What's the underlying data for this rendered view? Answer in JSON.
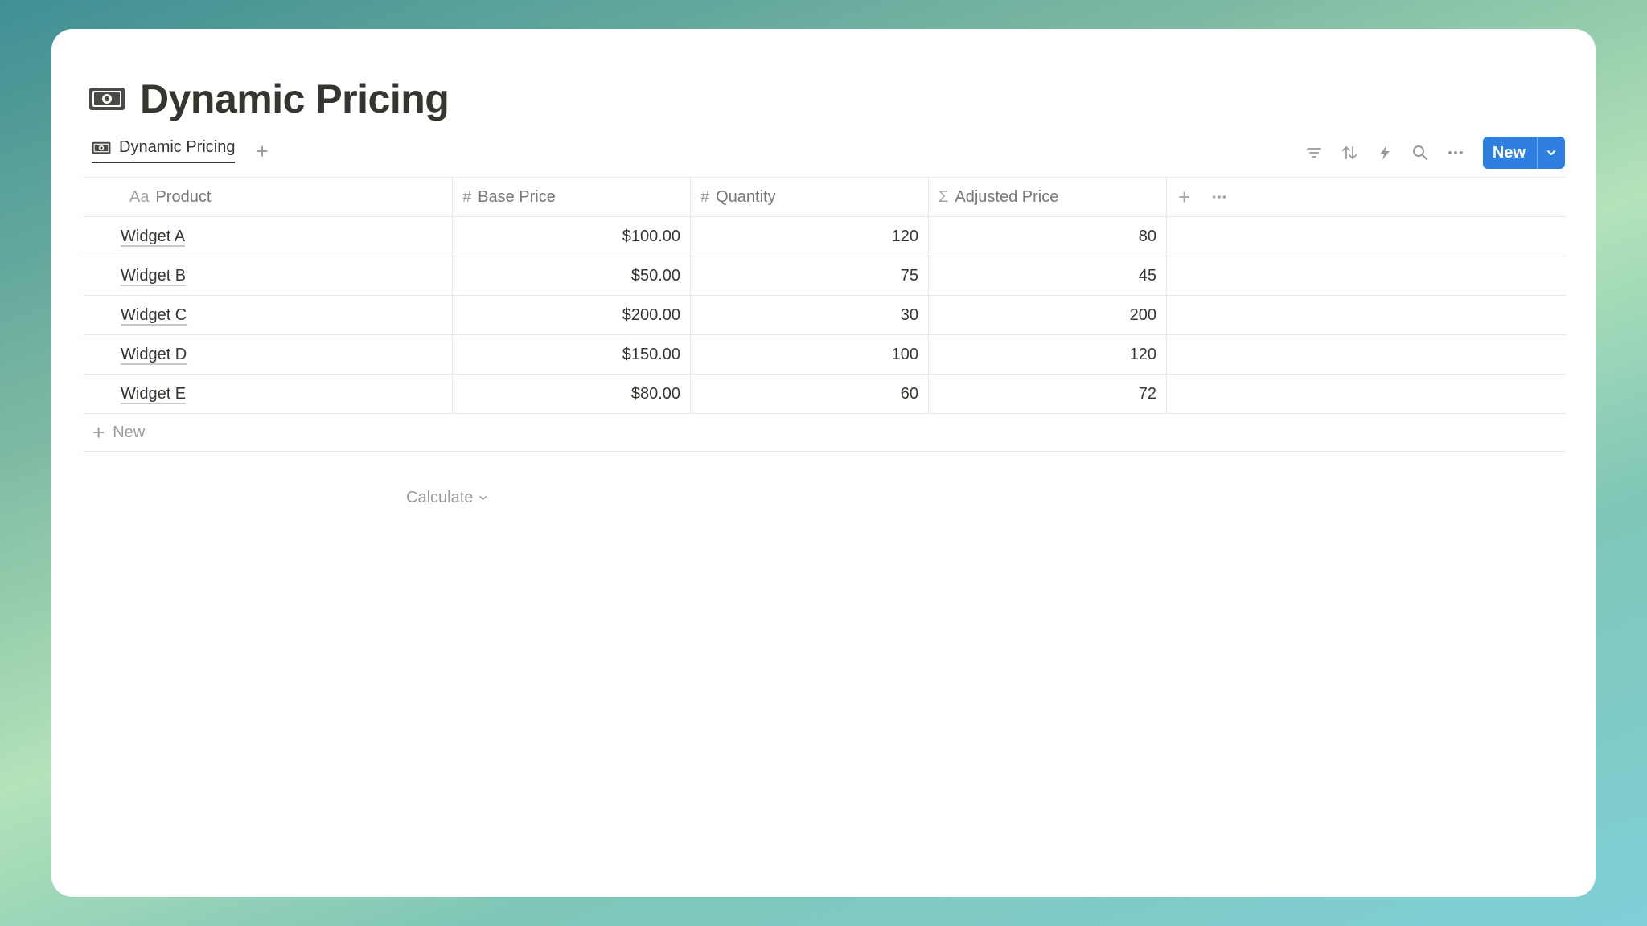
{
  "page": {
    "title": "Dynamic Pricing",
    "title_icon": "banknote-icon"
  },
  "view": {
    "tab_label": "Dynamic Pricing",
    "tab_icon": "banknote-icon",
    "add_view_icon": "plus-icon"
  },
  "toolbar": {
    "icons": [
      "filter-icon",
      "sort-icon",
      "automation-bolt-icon",
      "search-icon",
      "more-icon"
    ],
    "new_label": "New",
    "new_caret_icon": "chevron-down-icon"
  },
  "table": {
    "columns": [
      {
        "label": "Product",
        "icon": "Aa"
      },
      {
        "label": "Base Price",
        "icon": "#"
      },
      {
        "label": "Quantity",
        "icon": "#"
      },
      {
        "label": "Adjusted Price",
        "icon": "Σ"
      }
    ],
    "rows": [
      {
        "product": "Widget A",
        "base_price": "$100.00",
        "quantity": "120",
        "adjusted_price": "80"
      },
      {
        "product": "Widget B",
        "base_price": "$50.00",
        "quantity": "75",
        "adjusted_price": "45"
      },
      {
        "product": "Widget C",
        "base_price": "$200.00",
        "quantity": "30",
        "adjusted_price": "200"
      },
      {
        "product": "Widget D",
        "base_price": "$150.00",
        "quantity": "100",
        "adjusted_price": "120"
      },
      {
        "product": "Widget E",
        "base_price": "$80.00",
        "quantity": "60",
        "adjusted_price": "72"
      }
    ],
    "new_row_label": "New",
    "calculate_label": "Calculate"
  },
  "colors": {
    "accent": "#2f7fe0",
    "text": "#37352f",
    "muted": "#9b9a97",
    "border": "#e9e9e7"
  }
}
